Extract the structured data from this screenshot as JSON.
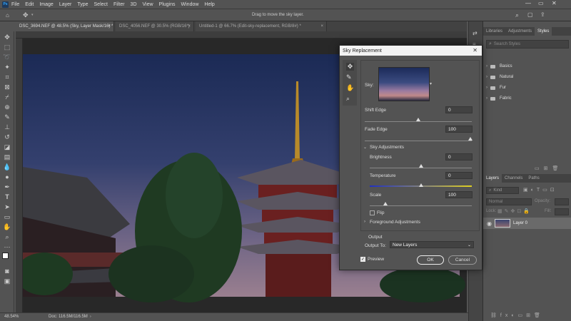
{
  "app": {
    "logo": "Ps"
  },
  "menubar": {
    "items": [
      "File",
      "Edit",
      "Image",
      "Layer",
      "Type",
      "Select",
      "Filter",
      "3D",
      "View",
      "Plugins",
      "Window",
      "Help"
    ]
  },
  "options_bar": {
    "hint": "Drag to move the sky layer."
  },
  "doc_tabs": [
    {
      "label": "DSC_3694.NEF @ 48.5% (Sky, Layer Mask/16) *",
      "active": true
    },
    {
      "label": "DSC_4056.NEF @ 30.5% (RGB/16*)",
      "active": false
    },
    {
      "label": "Untitled-1 @ 66.7% (Edit-sky-replacement, RGB/8#) *",
      "active": false
    }
  ],
  "status": {
    "zoom": "48.54%",
    "doc": "Doc: 116.5M/116.5M"
  },
  "styles_panel": {
    "tabs": [
      "Libraries",
      "Adjustments",
      "Styles"
    ],
    "search_placeholder": "Search Styles",
    "items": [
      "Basics",
      "Natural",
      "Fur",
      "Fabric"
    ]
  },
  "layers_panel": {
    "tabs": [
      "Layers",
      "Channels",
      "Paths"
    ],
    "filter_label": "Kind",
    "blend_mode": "Normal",
    "opacity_label": "Opacity:",
    "lock_label": "Lock:",
    "fill_label": "Fill:",
    "layer_name": "Layer 0"
  },
  "dialog": {
    "title": "Sky Replacement",
    "sky_label": "Sky:",
    "shift_edge_label": "Shift Edge",
    "shift_edge_value": "0",
    "fade_edge_label": "Fade Edge",
    "fade_edge_value": "100",
    "sky_adjustments_label": "Sky Adjustments",
    "brightness_label": "Brightness",
    "brightness_value": "0",
    "temperature_label": "Temperature",
    "temperature_value": "0",
    "scale_label": "Scale",
    "scale_value": "100",
    "flip_label": "Flip",
    "foreground_label": "Foreground Adjustments",
    "output_section": "Output",
    "output_to_label": "Output To:",
    "output_to_value": "New Layers",
    "preview_label": "Preview",
    "ok_label": "OK",
    "cancel_label": "Cancel"
  },
  "colors": {
    "accent": "#31a8ff",
    "panel": "#535353",
    "dark": "#282828"
  }
}
